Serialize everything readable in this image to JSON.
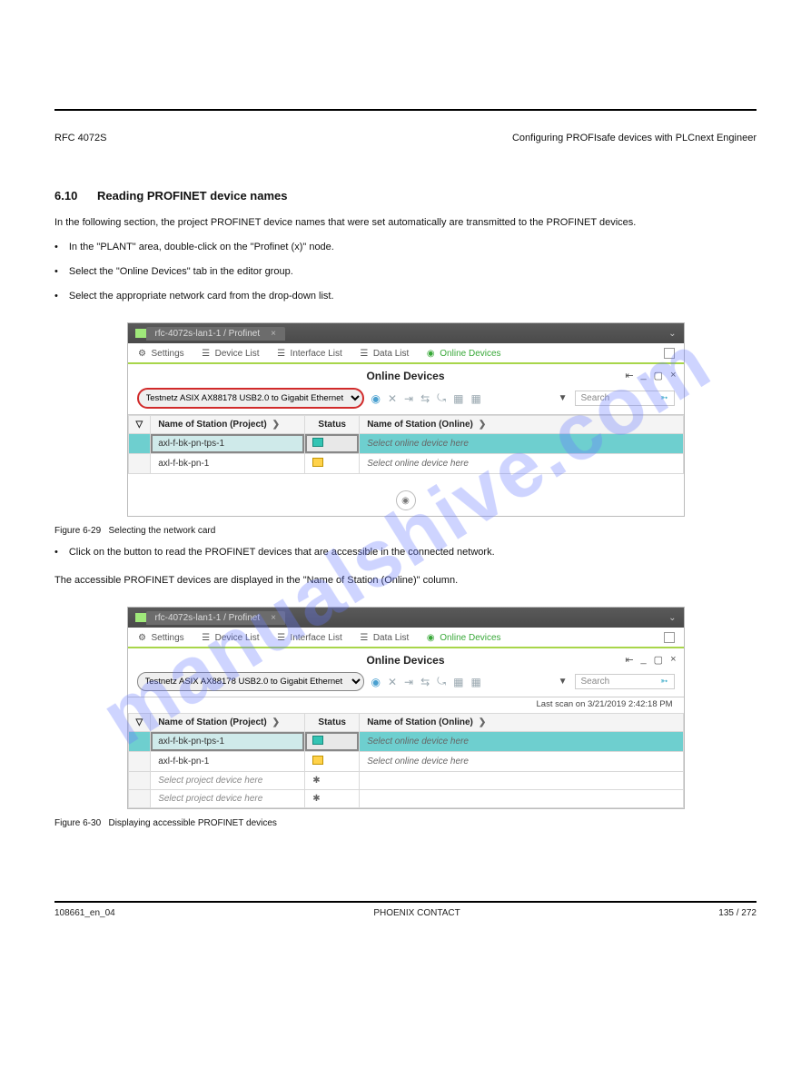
{
  "page": {
    "header_left": "RFC 4072S",
    "header_right_prefix": "Configuring PROFIsafe devices with ",
    "header_right_tool": "PLCnext Engineer",
    "section_number": "6.10",
    "section_title": "Reading PROFINET device names",
    "intro": "In the following section, the project PROFINET device names that were set automatically are transmitted to the PROFINET devices.",
    "steps": [
      "In the \"PLANT\" area, double-click on the \"Profinet (x)\" node.",
      "Select the \"Online Devices\" tab in the editor group.",
      "Select the appropriate network card from the drop-down list."
    ],
    "fig1_caption_label": "Figure 6-29",
    "fig1_caption_text": "Selecting the network card",
    "step_4": "Click on the       button to read the PROFINET devices that are accessible in the connected network.",
    "result": "The accessible PROFINET devices are displayed in the \"Name of Station (Online)\" column.",
    "fig2_caption_label": "Figure 6-30",
    "fig2_caption_text": "Displaying accessible PROFINET devices",
    "footer_left": "108661_en_04",
    "footer_center": "PHOENIX CONTACT",
    "footer_right": "135 / 272"
  },
  "app": {
    "tab_title": "rfc-4072s-lan1-1 / Profinet",
    "tabs": [
      "Settings",
      "Device List",
      "Interface List",
      "Data List",
      "Online Devices"
    ],
    "panel_title": "Online Devices",
    "network_card": "Testnetz ASIX AX88178 USB2.0 to Gigabit Ethernet ...",
    "search_placeholder": "Search",
    "columns": {
      "project": "Name of Station (Project)",
      "status": "Status",
      "online": "Name of Station (Online)"
    },
    "online_placeholder": "Select online device here",
    "project_placeholder": "Select project device here",
    "last_scan": "Last scan on 3/21/2019 2:42:18 PM"
  },
  "fig1_rows": [
    {
      "project": "axl-f-bk-pn-tps-1",
      "status": "ok",
      "online_placeholder": true,
      "selected": true
    },
    {
      "project": "axl-f-bk-pn-1",
      "status": "conn",
      "online_placeholder": true
    }
  ],
  "fig2_rows": [
    {
      "project": "axl-f-bk-pn-tps-1",
      "status": "ok",
      "online_placeholder": true,
      "selected": true
    },
    {
      "project": "axl-f-bk-pn-1",
      "status": "conn",
      "online_placeholder": true
    },
    {
      "project_placeholder": true,
      "status": "gear"
    },
    {
      "project_placeholder": true,
      "status": "gear"
    }
  ],
  "watermark": "manualshive.com"
}
